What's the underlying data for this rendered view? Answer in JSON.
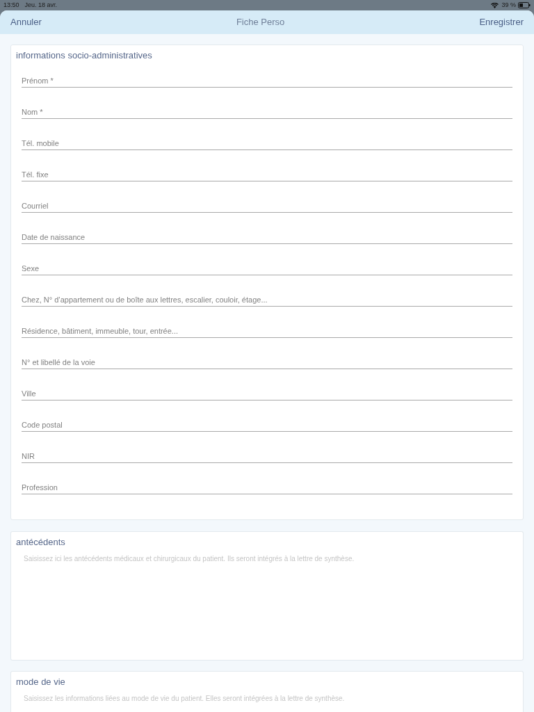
{
  "status_bar": {
    "time": "13:50",
    "date": "Jeu. 18 avr.",
    "battery": "39 %"
  },
  "nav": {
    "cancel": "Annuler",
    "title": "Fiche Perso",
    "save": "Enregistrer"
  },
  "sections": [
    {
      "kind": "fields",
      "title": "informations socio-administratives",
      "fields": [
        {
          "placeholder": "Prénom *"
        },
        {
          "placeholder": "Nom *"
        },
        {
          "placeholder": "Tél. mobile"
        },
        {
          "placeholder": "Tél. fixe"
        },
        {
          "placeholder": "Courriel"
        },
        {
          "placeholder": "Date de naissance"
        },
        {
          "placeholder": "Sexe"
        },
        {
          "placeholder": "Chez, N° d’appartement ou de boîte aux lettres, escalier, couloir, étage..."
        },
        {
          "placeholder": "Résidence, bâtiment, immeuble, tour, entrée..."
        },
        {
          "placeholder": "N° et libellé de la voie"
        },
        {
          "placeholder": "Ville"
        },
        {
          "placeholder": "Code postal"
        },
        {
          "placeholder": "NIR"
        },
        {
          "placeholder": "Profession"
        }
      ]
    },
    {
      "kind": "notes",
      "title": "antécédents",
      "placeholder": "Saisissez ici les antécédents médicaux et chirurgicaux du patient. Ils seront intégrés à la lettre de synthèse."
    },
    {
      "kind": "notes_cut",
      "title": "mode de vie",
      "placeholder": "Saisissez les informations liées au mode de vie du patient. Elles seront intégrées à la lettre de synthèse."
    }
  ]
}
